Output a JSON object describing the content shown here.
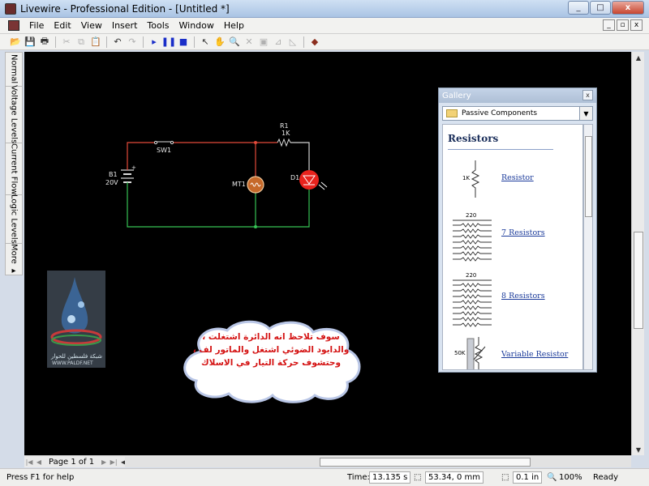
{
  "window": {
    "title": "Livewire - Professional Edition - [Untitled *]",
    "minimize": "_",
    "maximize": "□",
    "close": "x"
  },
  "menu": {
    "items": [
      "File",
      "Edit",
      "View",
      "Insert",
      "Tools",
      "Window",
      "Help"
    ],
    "mdi_buttons": [
      "_",
      "▫",
      "x"
    ]
  },
  "toolbar": {
    "buttons": [
      {
        "name": "open-icon",
        "glyph": "📂"
      },
      {
        "name": "save-icon",
        "glyph": "💾"
      },
      {
        "name": "print-icon",
        "glyph": "🖶"
      },
      {
        "name": "cut-icon",
        "glyph": "✂",
        "disabled": true
      },
      {
        "name": "copy-icon",
        "glyph": "⧉",
        "disabled": true
      },
      {
        "name": "paste-icon",
        "glyph": "📋",
        "disabled": true
      },
      {
        "name": "undo-icon",
        "glyph": "↶"
      },
      {
        "name": "redo-icon",
        "glyph": "↷",
        "disabled": true
      },
      {
        "name": "play-icon",
        "glyph": "▸",
        "color": "#1a2ec8"
      },
      {
        "name": "pause-icon",
        "glyph": "❚❚",
        "color": "#1a2ec8"
      },
      {
        "name": "stop-icon",
        "glyph": "■",
        "color": "#1a2ec8"
      },
      {
        "name": "select-arrow-icon",
        "glyph": "↖"
      },
      {
        "name": "hand-icon",
        "glyph": "✋"
      },
      {
        "name": "zoom-icon",
        "glyph": "🔍"
      },
      {
        "name": "delete-icon",
        "glyph": "✕",
        "disabled": true
      },
      {
        "name": "stamp-icon",
        "glyph": "▣",
        "disabled": true
      },
      {
        "name": "rotate-left-icon",
        "glyph": "⊿",
        "disabled": true
      },
      {
        "name": "rotate-right-icon",
        "glyph": "◺",
        "disabled": true
      },
      {
        "name": "component-icon",
        "glyph": "◆",
        "color": "#8b2e1e"
      }
    ]
  },
  "sidebar": {
    "tabs": [
      "Normal",
      "Voltage Levels",
      "Current Flow",
      "Logic Levels",
      "More ▸"
    ]
  },
  "circuit": {
    "switch": "SW1",
    "resistor_name": "R1",
    "resistor_value": "1K",
    "battery_name": "B1",
    "battery_value": "20V",
    "meter": "MT1",
    "led": "D1",
    "battery_plus": "+"
  },
  "watermark": {
    "arabic": "شبكة فلسطين للحوار",
    "url": "WWW.PALDF.NET"
  },
  "callout": {
    "line1": "سوف تلاحظ انه الدائرة اشتغلت ،",
    "line2": "والدايود الضوئي اشتغل والماتور لف ،",
    "line3": "وحتشوف حركة التيار  في الاسلاك"
  },
  "gallery": {
    "title": "Gallery",
    "close": "x",
    "category": "Passive Components",
    "heading": "Resistors",
    "items": [
      {
        "label": "Resistor",
        "value": "1K"
      },
      {
        "label": "7 Resistors",
        "value": "220"
      },
      {
        "label": "8 Resistors",
        "value": "220"
      },
      {
        "label": "Variable Resistor",
        "value": "50K"
      }
    ]
  },
  "page_nav": {
    "label": "Page 1 of 1"
  },
  "status": {
    "help": "Press F1 for help",
    "time_label": "Time:",
    "time_value": "13.135 s",
    "coords": "53.34, 0 mm",
    "grid": "0.1 in",
    "zoom": "100%",
    "state": "Ready"
  },
  "colors": {
    "wire_live": "#e34a3a",
    "wire_ground": "#36c254",
    "wire_neutral": "#c8c8c8",
    "led": "#e8231d"
  }
}
